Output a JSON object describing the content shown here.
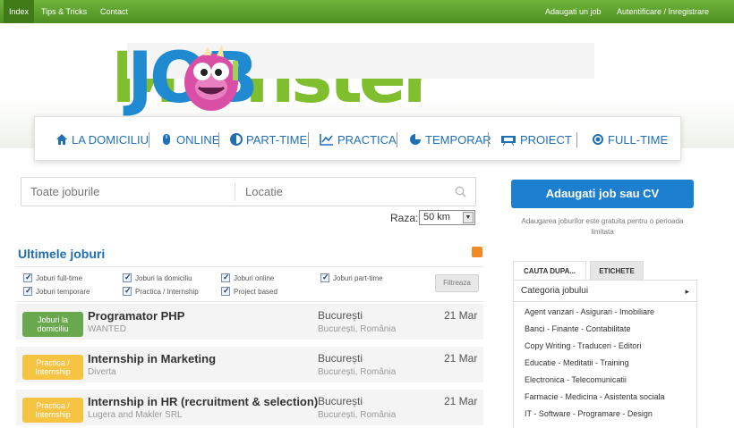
{
  "topnav": {
    "items": [
      "Index",
      "Tips & Tricks",
      "Contact"
    ],
    "right_items": [
      "Adaugati un job",
      "Autentificare / Inregistrare"
    ]
  },
  "logo": {
    "part1": "JOB",
    "part2": "M",
    "part3": "nster"
  },
  "categories": [
    {
      "label": "LA DOMICILIU",
      "icon": "home-icon"
    },
    {
      "label": "ONLINE",
      "icon": "mouse-icon"
    },
    {
      "label": "PART-TIME",
      "icon": "half-circle-icon"
    },
    {
      "label": "PRACTICA",
      "icon": "chart-icon"
    },
    {
      "label": "TEMPORAR",
      "icon": "pie-icon"
    },
    {
      "label": "PROIECT",
      "icon": "projector-icon"
    },
    {
      "label": "FULL-TIME",
      "icon": "target-icon"
    }
  ],
  "search": {
    "job_placeholder": "Toate joburile",
    "location_placeholder": "Locatie",
    "raza_label": "Raza:",
    "raza_value": "50 km"
  },
  "latest": {
    "title": "Ultimele joburi",
    "filters": [
      "Joburi full-time",
      "Joburi la domiciliu",
      "Joburi online",
      "Joburi part-time",
      "Joburi temporare",
      "Practica / Internship",
      "Project based"
    ],
    "filter_button": "Filtreaza"
  },
  "jobs": [
    {
      "badge": "Joburi la domiciliu",
      "badge_color": "#6aa84f",
      "title": "Programator PHP",
      "company": "WANTED",
      "city": "București",
      "region": "București, România",
      "date": "21 Mar"
    },
    {
      "badge": "Practica / Internship",
      "badge_color": "#f6c343",
      "title": "Internship in Marketing",
      "company": "Diverta",
      "city": "București",
      "region": "București, România",
      "date": "21 Mar"
    },
    {
      "badge": "Practica / Internship",
      "badge_color": "#f6c343",
      "title": "Internship in HR (recruitment & selection)",
      "company": "Lugera and Makler SRL",
      "city": "București",
      "region": "București, România",
      "date": "21 Mar"
    }
  ],
  "sidebar": {
    "add_button": "Adaugati job sau CV",
    "add_note": "Adaugarea joburilor este gratuita pentru o perioada limitata",
    "tabs": [
      "CAUTA DUPA...",
      "ETICHETE"
    ],
    "category_select": "Categoria jobului",
    "category_list": [
      "Agent vanzari - Asigurari - Imobiliare",
      "Banci - Finante - Contabilitate",
      "Copy Writing - Traduceri - Editori",
      "Educatie - Meditatii - Training",
      "Electronica - Telecomunicatii",
      "Farmacie - Medicina - Asistenta sociala",
      "IT - Software - Programare - Design"
    ]
  },
  "colors": {
    "accent_green": "#5ca02c",
    "accent_blue": "#1c7fd0"
  }
}
